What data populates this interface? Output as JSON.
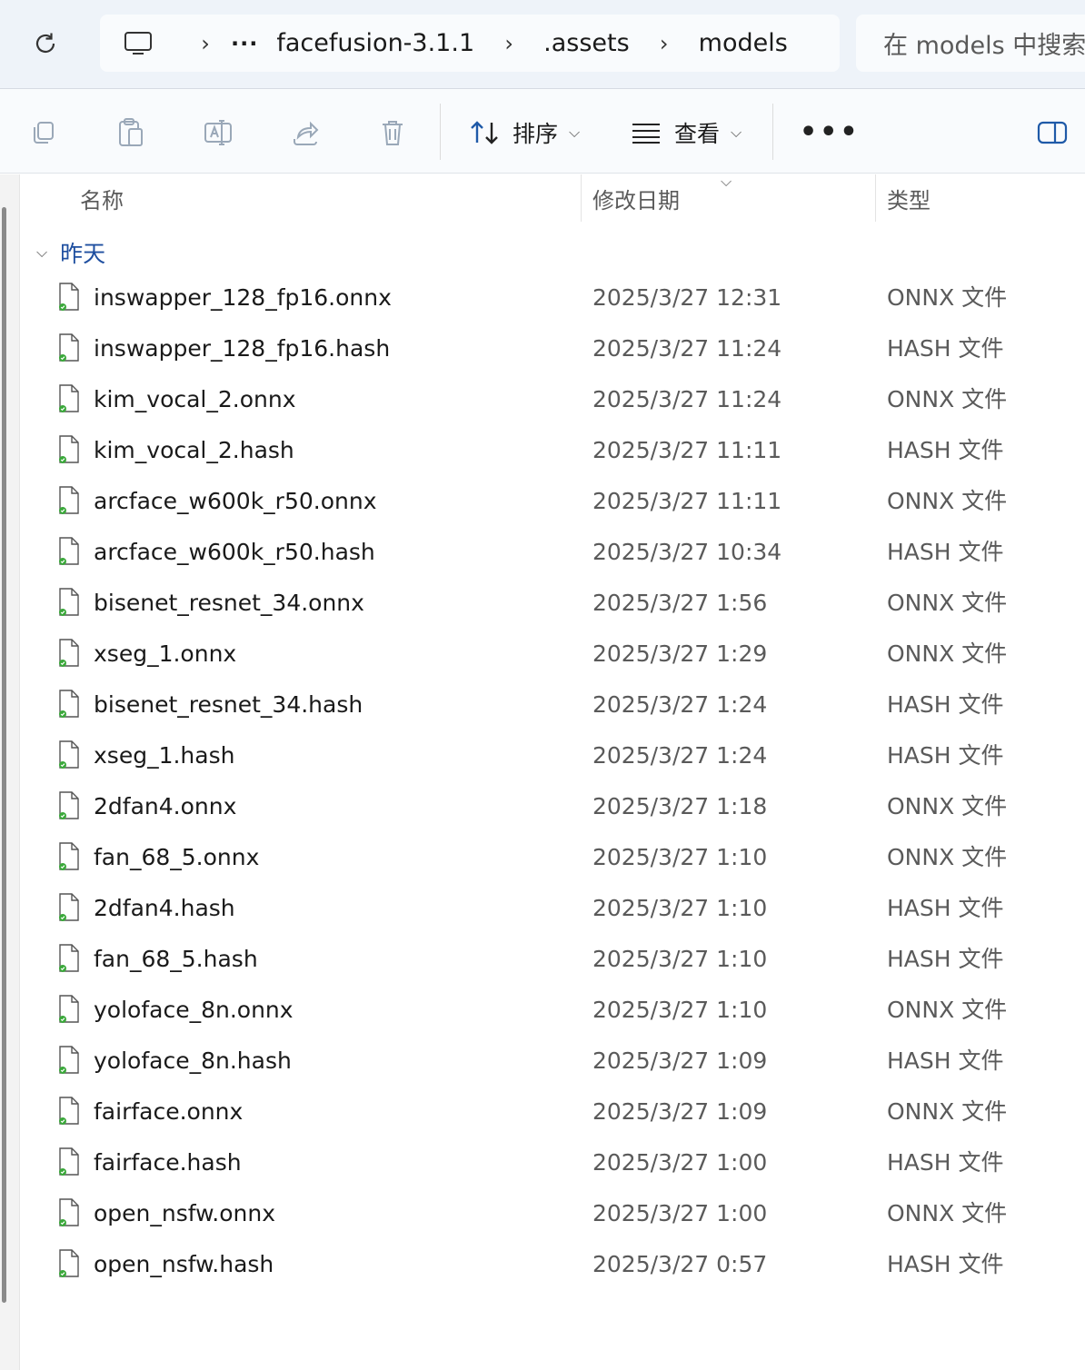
{
  "breadcrumb": {
    "overflow": "···",
    "items": [
      "facefusion-3.1.1",
      ".assets",
      "models"
    ]
  },
  "search": {
    "placeholder": "在 models 中搜索"
  },
  "toolbar": {
    "sort_label": "排序",
    "view_label": "查看",
    "more_label": "•••"
  },
  "columns": {
    "name": "名称",
    "date": "修改日期",
    "type": "类型"
  },
  "group": {
    "label": "昨天"
  },
  "files": [
    {
      "name": "inswapper_128_fp16.onnx",
      "date": "2025/3/27 12:31",
      "type": "ONNX 文件"
    },
    {
      "name": "inswapper_128_fp16.hash",
      "date": "2025/3/27 11:24",
      "type": "HASH 文件"
    },
    {
      "name": "kim_vocal_2.onnx",
      "date": "2025/3/27 11:24",
      "type": "ONNX 文件"
    },
    {
      "name": "kim_vocal_2.hash",
      "date": "2025/3/27 11:11",
      "type": "HASH 文件"
    },
    {
      "name": "arcface_w600k_r50.onnx",
      "date": "2025/3/27 11:11",
      "type": "ONNX 文件"
    },
    {
      "name": "arcface_w600k_r50.hash",
      "date": "2025/3/27 10:34",
      "type": "HASH 文件"
    },
    {
      "name": "bisenet_resnet_34.onnx",
      "date": "2025/3/27 1:56",
      "type": "ONNX 文件"
    },
    {
      "name": "xseg_1.onnx",
      "date": "2025/3/27 1:29",
      "type": "ONNX 文件"
    },
    {
      "name": "bisenet_resnet_34.hash",
      "date": "2025/3/27 1:24",
      "type": "HASH 文件"
    },
    {
      "name": "xseg_1.hash",
      "date": "2025/3/27 1:24",
      "type": "HASH 文件"
    },
    {
      "name": "2dfan4.onnx",
      "date": "2025/3/27 1:18",
      "type": "ONNX 文件"
    },
    {
      "name": "fan_68_5.onnx",
      "date": "2025/3/27 1:10",
      "type": "ONNX 文件"
    },
    {
      "name": "2dfan4.hash",
      "date": "2025/3/27 1:10",
      "type": "HASH 文件"
    },
    {
      "name": "fan_68_5.hash",
      "date": "2025/3/27 1:10",
      "type": "HASH 文件"
    },
    {
      "name": "yoloface_8n.onnx",
      "date": "2025/3/27 1:10",
      "type": "ONNX 文件"
    },
    {
      "name": "yoloface_8n.hash",
      "date": "2025/3/27 1:09",
      "type": "HASH 文件"
    },
    {
      "name": "fairface.onnx",
      "date": "2025/3/27 1:09",
      "type": "ONNX 文件"
    },
    {
      "name": "fairface.hash",
      "date": "2025/3/27 1:00",
      "type": "HASH 文件"
    },
    {
      "name": "open_nsfw.onnx",
      "date": "2025/3/27 1:00",
      "type": "ONNX 文件"
    },
    {
      "name": "open_nsfw.hash",
      "date": "2025/3/27 0:57",
      "type": "HASH 文件"
    }
  ]
}
